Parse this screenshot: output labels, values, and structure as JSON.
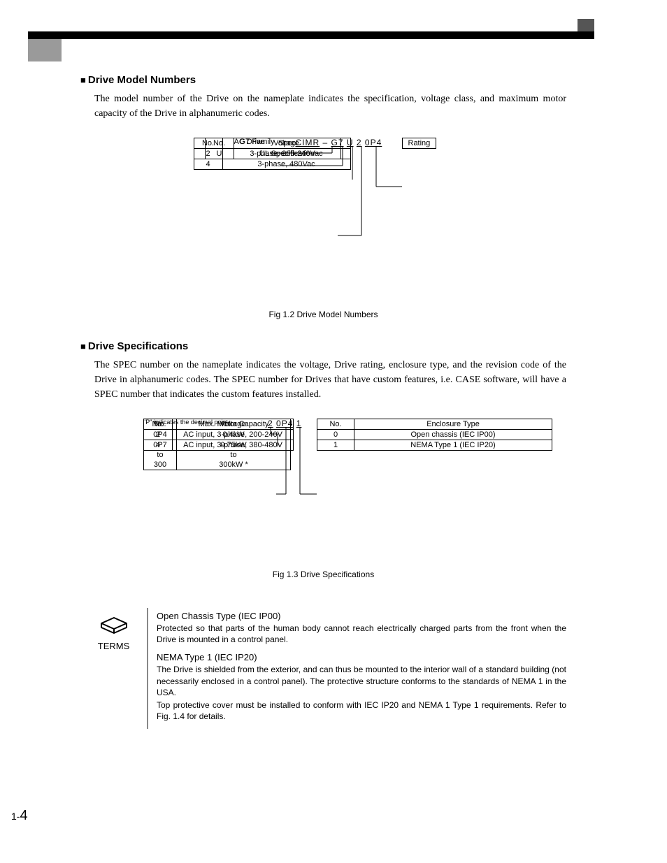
{
  "section1": {
    "heading": "Drive Model Numbers",
    "para": "The model number of the Drive on the nameplate indicates the specification, voltage class, and maximum motor capacity of the Drive in alphanumeric codes."
  },
  "fig1": {
    "code": {
      "p1": "CIMR",
      "p2": "G7",
      "p3": "U",
      "p4": "2",
      "p5": "0P4"
    },
    "ac_drive": "AC Drive",
    "g7_family": "G7 Family",
    "spec_table": {
      "h1": "No.",
      "h2": "Spec",
      "r1c1": "U",
      "r1c2": "UL Specification"
    },
    "voltage_table": {
      "h1": "No.",
      "h2": "Voltage",
      "r1c1": "2",
      "r1c2": "3-phase, 208-240Vac",
      "r2c1": "4",
      "r2c2": "3-phase, 480Vac"
    },
    "rating_box": "Rating",
    "caption": "Fig 1.2   Drive Model Numbers"
  },
  "section2": {
    "heading": "Drive Specifications",
    "para": "The SPEC number on the nameplate indicates the voltage, Drive rating, enclosure type, and the revision code of the Drive in alphanumeric codes. The SPEC number for Drives that have custom features, i.e. CASE software, will have a SPEC number that indicates the custom features installed."
  },
  "fig2": {
    "code": {
      "p1": "2",
      "p2": "0P4",
      "p3": "1"
    },
    "voltage_table": {
      "h1": "No.",
      "h2": "Voltage",
      "r1c1": "2",
      "r1c2": "AC input, 3-phase, 200-240V",
      "r2c1": "4",
      "r2c2": "AC input, 3-phase, 380-480V"
    },
    "capacity_table": {
      "h1": "No.",
      "h2": "Max. Motor Capacity",
      "r1c1": "0P4",
      "r1c2": "0.4kW",
      "r2c1": "0P7",
      "r2c2": "0.75kW",
      "r3c1": "to",
      "r3c2": "to",
      "r4c1": "300",
      "r4c2": "300kW *"
    },
    "enclosure_table": {
      "h1": "No.",
      "h2": "Enclosure Type",
      "r1c1": "0",
      "r1c2": "Open chassis (IEC IP00)",
      "r2c1": "1",
      "r2c2": "NEMA Type 1 (IEC IP20)"
    },
    "footnote": "\"P\" indicates the decimal point",
    "caption": "Fig 1.3   Drive Specifications"
  },
  "terms": {
    "label": "TERMS",
    "t1_title": "Open Chassis Type (IEC IP00)",
    "t1_body": "Protected so that parts of the human body cannot reach electrically charged parts from the front when the Drive is mounted in a control panel.",
    "t2_title": "NEMA Type 1 (IEC IP20)",
    "t2_body1": "The Drive is shielded from the exterior, and can thus be mounted to the interior wall of a standard building (not necessarily enclosed in a control panel). The protective structure conforms to the standards of NEMA 1 in the USA.",
    "t2_body2": "Top protective cover must be installed to conform with IEC IP20 and NEMA 1 Type 1 requirements. Refer to Fig. 1.4 for details."
  },
  "page": {
    "chapter": "1",
    "sep": "-",
    "num": "4"
  }
}
